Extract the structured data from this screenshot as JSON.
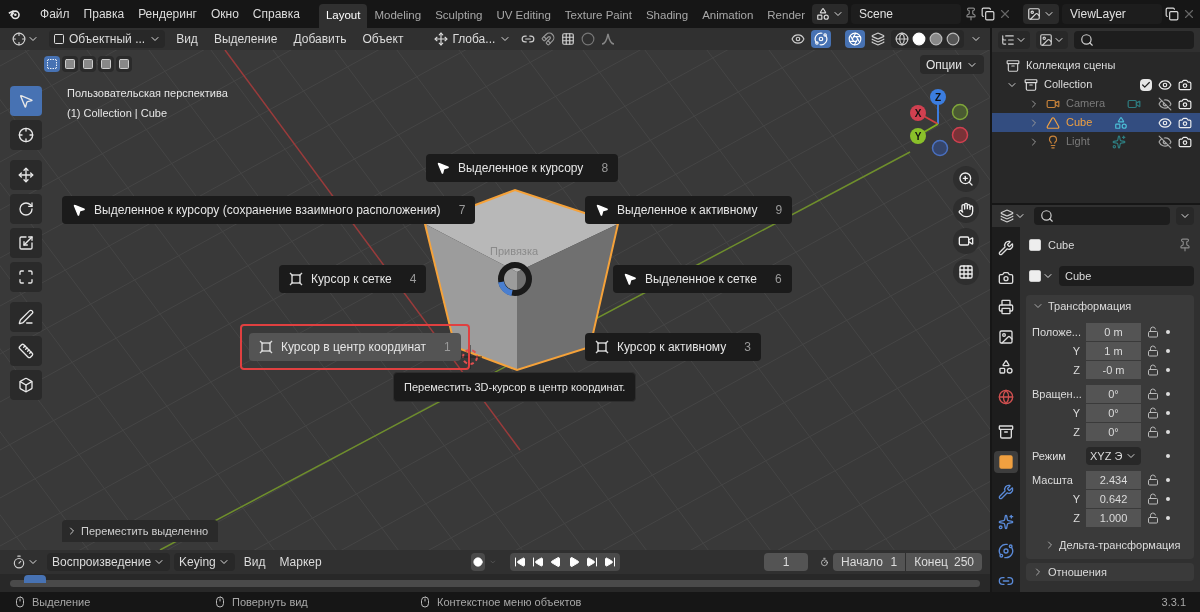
{
  "menu": [
    "Файл",
    "Правка",
    "Рендеринг",
    "Окно",
    "Справка"
  ],
  "workspaces": [
    {
      "label": "Layout",
      "selected": true
    },
    {
      "label": "Modeling",
      "selected": false
    },
    {
      "label": "Sculpting",
      "selected": false
    },
    {
      "label": "UV Editing",
      "selected": false
    },
    {
      "label": "Texture Paint",
      "selected": false
    },
    {
      "label": "Shading",
      "selected": false
    },
    {
      "label": "Animation",
      "selected": false
    },
    {
      "label": "Render",
      "selected": false
    }
  ],
  "scene": "Scene",
  "view_layer": "ViewLayer",
  "viewport_header": {
    "mode": "Объектный ...",
    "menus": [
      "Вид",
      "Выделение",
      "Добавить",
      "Объект"
    ],
    "orientation": "Глоба...",
    "options": "Опции"
  },
  "viewport": {
    "view_name": "Пользовательская перспектива",
    "object_info": "(1) Collection | Cube",
    "tools": [
      {
        "kind": "select",
        "selected": true
      },
      {
        "kind": "cursor",
        "selected": false
      },
      {
        "kind": "move",
        "selected": false
      },
      {
        "kind": "rotate",
        "selected": false
      },
      {
        "kind": "scale",
        "selected": false
      },
      {
        "kind": "transform",
        "selected": false
      },
      {
        "kind": "annotate",
        "selected": false
      },
      {
        "kind": "measure",
        "selected": false
      },
      {
        "kind": "add-cube",
        "selected": false
      }
    ],
    "gizmo": {
      "x": "X",
      "y": "Y",
      "z": "Z"
    },
    "last_operator": "Переместить выделенно"
  },
  "pie_menu": {
    "title": "Привязка",
    "items": [
      {
        "label": "Выделенное к курсору",
        "shortcut": "8",
        "kind": "arrow",
        "selected": false
      },
      {
        "label": "Выделенное к курсору (сохранение взаимного расположения)",
        "shortcut": "7",
        "kind": "arrow",
        "selected": false
      },
      {
        "label": "Выделенное к активному",
        "shortcut": "9",
        "kind": "arrow",
        "selected": false
      },
      {
        "label": "Курсор к сетке",
        "shortcut": "4",
        "kind": "cursor",
        "selected": false
      },
      {
        "label": "Выделенное к сетке",
        "shortcut": "6",
        "kind": "arrow",
        "selected": false
      },
      {
        "label": "Курсор в центр координат",
        "shortcut": "1",
        "kind": "cursor",
        "selected": true
      },
      {
        "label": "Курсор к активному",
        "shortcut": "3",
        "kind": "cursor",
        "selected": false
      }
    ],
    "tooltip": "Переместить 3D-курсор в центр координат."
  },
  "outliner": {
    "root": "Коллекция сцены",
    "items": [
      {
        "name": "Collection",
        "kind": "collection",
        "expanded": true,
        "checked": true,
        "visible": true,
        "selected": false,
        "children": [
          {
            "name": "Camera",
            "kind": "camera",
            "expanded": false,
            "visible": false,
            "selected": false
          },
          {
            "name": "Cube",
            "kind": "mesh",
            "expanded": false,
            "visible": true,
            "selected": true
          },
          {
            "name": "Light",
            "kind": "light",
            "expanded": false,
            "visible": false,
            "selected": false
          }
        ]
      }
    ]
  },
  "properties": {
    "object_name": "Cube",
    "data_name": "Cube",
    "tabs": [
      {
        "kind": "tool",
        "selected": false
      },
      {
        "kind": "render",
        "selected": false
      },
      {
        "kind": "output",
        "selected": false
      },
      {
        "kind": "view-layer",
        "selected": false
      },
      {
        "kind": "scene",
        "selected": false
      },
      {
        "kind": "world",
        "selected": false
      },
      {
        "kind": "collection",
        "selected": false
      },
      {
        "kind": "object",
        "selected": true
      },
      {
        "kind": "modifier",
        "selected": false
      },
      {
        "kind": "particles",
        "selected": false
      },
      {
        "kind": "physics",
        "selected": false
      },
      {
        "kind": "constraints",
        "selected": false
      }
    ],
    "panel": {
      "title": "Трансформация",
      "expanded": true,
      "groups": [
        {
          "rows": [
            {
              "label": "Положе...",
              "value": "0 m",
              "kind": "field"
            },
            {
              "label": "Y",
              "value": "1 m",
              "kind": "field"
            },
            {
              "label": "Z",
              "value": "-0 m",
              "kind": "field"
            }
          ]
        },
        {
          "rows": [
            {
              "label": "Вращен...",
              "value": "0°",
              "kind": "field"
            },
            {
              "label": "Y",
              "value": "0°",
              "kind": "field"
            },
            {
              "label": "Z",
              "value": "0°",
              "kind": "field"
            }
          ]
        },
        {
          "rows": [
            {
              "label": "Режим",
              "value": "XYZ Э",
              "kind": "dropdown"
            }
          ]
        },
        {
          "rows": [
            {
              "label": "Масшта",
              "value": "2.434",
              "kind": "field"
            },
            {
              "label": "Y",
              "value": "0.642",
              "kind": "field"
            },
            {
              "label": "Z",
              "value": "1.000",
              "kind": "field"
            }
          ]
        }
      ],
      "subpanels": [
        {
          "title": "Дельта-трансформация",
          "expanded": false
        }
      ]
    },
    "next_panel": {
      "title": "Отношения",
      "expanded": false
    }
  },
  "timeline": {
    "menus": [
      "Воспроизведение",
      "Keying",
      "Вид",
      "Маркер"
    ],
    "current_frame": "1",
    "start_label": "Начало",
    "start": "1",
    "end_label": "Конец",
    "end": "250"
  },
  "status": {
    "hints": [
      "Выделение",
      "Повернуть вид",
      "Контекстное меню объектов"
    ],
    "version": "3.3.1"
  }
}
